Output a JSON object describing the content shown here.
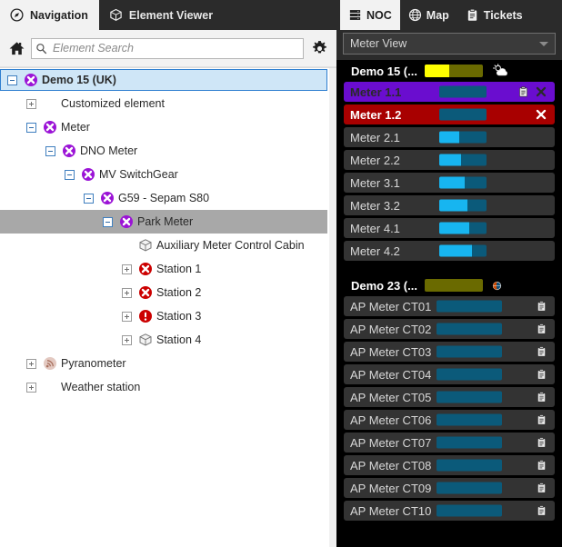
{
  "left": {
    "tabs": [
      {
        "label": "Navigation",
        "icon": "compass-icon",
        "active": true
      },
      {
        "label": "Element Viewer",
        "icon": "cube-icon",
        "active": false
      }
    ],
    "search": {
      "placeholder": "Element Search",
      "value": "",
      "icon": "search-icon"
    },
    "home_icon": "home-icon",
    "settings_icon": "gear-icon",
    "tree": [
      {
        "label": "Demo 15 (UK)",
        "indent": 0,
        "toggle": "minus",
        "icon": "error-x-purple-icon",
        "state": "selected-blue",
        "bold": true
      },
      {
        "label": "Customized element",
        "indent": 1,
        "toggle": "plus-gray",
        "icon": "none",
        "state": "",
        "bold": false
      },
      {
        "label": "Meter",
        "indent": 1,
        "toggle": "minus",
        "icon": "error-x-purple-icon",
        "state": "",
        "bold": false
      },
      {
        "label": "DNO Meter",
        "indent": 2,
        "toggle": "minus",
        "icon": "error-x-purple-icon",
        "state": "",
        "bold": false
      },
      {
        "label": "MV SwitchGear",
        "indent": 3,
        "toggle": "minus",
        "icon": "error-x-purple-icon",
        "state": "",
        "bold": false
      },
      {
        "label": "G59 - Sepam S80",
        "indent": 4,
        "toggle": "minus",
        "icon": "error-x-purple-icon",
        "state": "",
        "bold": false
      },
      {
        "label": "Park Meter",
        "indent": 5,
        "toggle": "minus",
        "icon": "error-x-purple-icon",
        "state": "selected-gray",
        "bold": false
      },
      {
        "label": "Auxiliary Meter Control Cabin",
        "indent": 6,
        "toggle": "none",
        "icon": "cube-gray-icon",
        "state": "",
        "bold": false
      },
      {
        "label": "Station 1",
        "indent": 6,
        "toggle": "plus-gray",
        "icon": "error-x-red-icon",
        "state": "",
        "bold": false
      },
      {
        "label": "Station 2",
        "indent": 6,
        "toggle": "plus-gray",
        "icon": "error-x-red-icon",
        "state": "",
        "bold": false
      },
      {
        "label": "Station 3",
        "indent": 6,
        "toggle": "plus-gray",
        "icon": "alert-exclaim-red-icon",
        "state": "",
        "bold": false
      },
      {
        "label": "Station 4",
        "indent": 6,
        "toggle": "plus-gray",
        "icon": "cube-gray-icon",
        "state": "",
        "bold": false
      },
      {
        "label": "Pyranometer",
        "indent": 1,
        "toggle": "plus-gray",
        "icon": "sensor-signal-icon",
        "state": "",
        "bold": false
      },
      {
        "label": "Weather station",
        "indent": 1,
        "toggle": "plus-gray",
        "icon": "none",
        "state": "",
        "bold": false
      }
    ]
  },
  "right": {
    "tabs": [
      {
        "label": "NOC",
        "icon": "server-rack-icon",
        "active": true
      },
      {
        "label": "Map",
        "icon": "globe-icon",
        "active": false
      },
      {
        "label": "Tickets",
        "icon": "clipboard-icon",
        "active": false
      }
    ],
    "view_select": {
      "value": "Meter View",
      "caret": "chevron-down-icon"
    },
    "groups": [
      {
        "title": "Demo 15 (...",
        "bar": {
          "fill_pct": 42,
          "fill_color": "#ffff00",
          "track_color": "#6a6a00"
        },
        "icon": "weather-partly-cloudy-icon",
        "rows": [
          {
            "name": "Meter 1.1",
            "severity": "major",
            "bar_fill_pct": 0,
            "icons": [
              "clipboard-icon",
              "close-x-icon"
            ]
          },
          {
            "name": "Meter 1.2",
            "severity": "critical",
            "bar_fill_pct": 0,
            "icons": [
              "close-x-icon"
            ]
          },
          {
            "name": "Meter 2.1",
            "severity": "normal",
            "bar_fill_pct": 42,
            "icons": []
          },
          {
            "name": "Meter 2.2",
            "severity": "normal",
            "bar_fill_pct": 46,
            "icons": []
          },
          {
            "name": "Meter 3.1",
            "severity": "normal",
            "bar_fill_pct": 53,
            "icons": []
          },
          {
            "name": "Meter 3.2",
            "severity": "normal",
            "bar_fill_pct": 60,
            "icons": []
          },
          {
            "name": "Meter 4.1",
            "severity": "normal",
            "bar_fill_pct": 63,
            "icons": []
          },
          {
            "name": "Meter 4.2",
            "severity": "normal",
            "bar_fill_pct": 70,
            "icons": []
          }
        ]
      },
      {
        "title": "Demo 23 (...",
        "bar": {
          "fill_pct": 0,
          "fill_color": "#ffff00",
          "track_color": "#6a6a00"
        },
        "icon": "globe-small-icon",
        "rows": [
          {
            "name": "AP Meter CT01",
            "severity": "normal",
            "bar_fill_pct": 0,
            "icons": [
              "clipboard-icon"
            ]
          },
          {
            "name": "AP Meter CT02",
            "severity": "normal",
            "bar_fill_pct": 0,
            "icons": [
              "clipboard-icon"
            ]
          },
          {
            "name": "AP Meter CT03",
            "severity": "normal",
            "bar_fill_pct": 0,
            "icons": [
              "clipboard-icon"
            ]
          },
          {
            "name": "AP Meter CT04",
            "severity": "normal",
            "bar_fill_pct": 0,
            "icons": [
              "clipboard-icon"
            ]
          },
          {
            "name": "AP Meter CT05",
            "severity": "normal",
            "bar_fill_pct": 0,
            "icons": [
              "clipboard-icon"
            ]
          },
          {
            "name": "AP Meter CT06",
            "severity": "normal",
            "bar_fill_pct": 0,
            "icons": [
              "clipboard-icon"
            ]
          },
          {
            "name": "AP Meter CT07",
            "severity": "normal",
            "bar_fill_pct": 0,
            "icons": [
              "clipboard-icon"
            ]
          },
          {
            "name": "AP Meter CT08",
            "severity": "normal",
            "bar_fill_pct": 0,
            "icons": [
              "clipboard-icon"
            ]
          },
          {
            "name": "AP Meter CT09",
            "severity": "normal",
            "bar_fill_pct": 0,
            "icons": [
              "clipboard-icon"
            ]
          },
          {
            "name": "AP Meter CT10",
            "severity": "normal",
            "bar_fill_pct": 0,
            "icons": [
              "clipboard-icon"
            ]
          }
        ]
      }
    ]
  },
  "colors": {
    "tabbar": "#2b2b2b",
    "panel_bg": "#000000",
    "row_bg": "#333333",
    "critical": "#a80000",
    "major": "#6a0dcf",
    "bar_track": "#0b5a7a",
    "bar_fill": "#17b5f0",
    "selection_blue": "#cfe6f7",
    "selection_gray": "#a8a8a8"
  }
}
